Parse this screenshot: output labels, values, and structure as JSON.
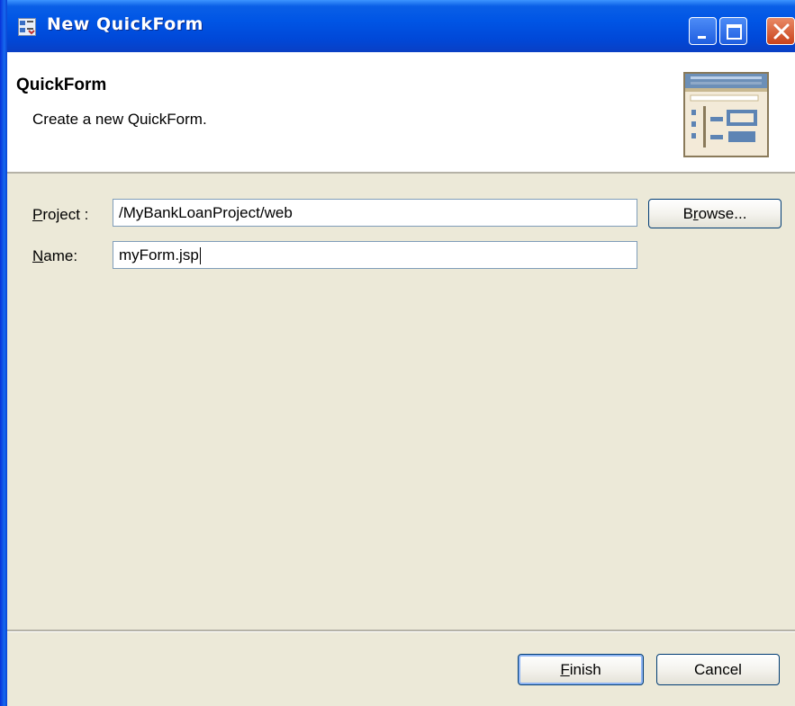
{
  "window": {
    "title": "New QuickForm",
    "titlebar_color": "#0055e5"
  },
  "header": {
    "title": "QuickForm",
    "description": "Create a new QuickForm."
  },
  "form": {
    "project_label_mnemonic": "P",
    "project_label_rest": "roject :",
    "project_value": "/MyBankLoanProject/web",
    "name_label_mnemonic": "N",
    "name_label_rest": "ame:",
    "name_value": "myForm.jsp",
    "browse_pre": "B",
    "browse_mnemonic": "r",
    "browse_post": "owse..."
  },
  "footer": {
    "finish_mnemonic": "F",
    "finish_rest": "inish",
    "cancel_label": "Cancel"
  },
  "icons": {
    "title_icon": "quickform-wizard-icon",
    "header_icon": "form-layout-icon",
    "minimize": "minimize-icon",
    "maximize": "maximize-icon",
    "close": "close-icon"
  }
}
